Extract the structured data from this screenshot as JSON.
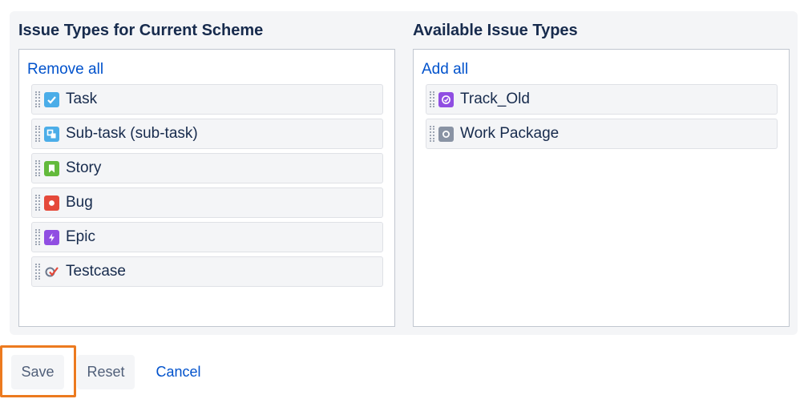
{
  "current": {
    "title": "Issue Types for Current Scheme",
    "action": "Remove all",
    "items": [
      {
        "label": "Task",
        "icon": "task-icon",
        "color": "#4bade8"
      },
      {
        "label": "Sub-task (sub-task)",
        "icon": "subtask-icon",
        "color": "#4bade8"
      },
      {
        "label": "Story",
        "icon": "story-icon",
        "color": "#63ba3c"
      },
      {
        "label": "Bug",
        "icon": "bug-icon",
        "color": "#e5493a"
      },
      {
        "label": "Epic",
        "icon": "epic-icon",
        "color": "#904ee2"
      },
      {
        "label": "Testcase",
        "icon": "testcase-icon",
        "color": "#e5493a"
      }
    ]
  },
  "available": {
    "title": "Available Issue Types",
    "action": "Add all",
    "items": [
      {
        "label": "Track_Old",
        "icon": "track-icon",
        "color": "#904ee2"
      },
      {
        "label": "Work Package",
        "icon": "work-package-icon",
        "color": "#8993a4"
      }
    ]
  },
  "buttons": {
    "save": "Save",
    "reset": "Reset",
    "cancel": "Cancel"
  },
  "highlight_color": "#ec7a1f"
}
